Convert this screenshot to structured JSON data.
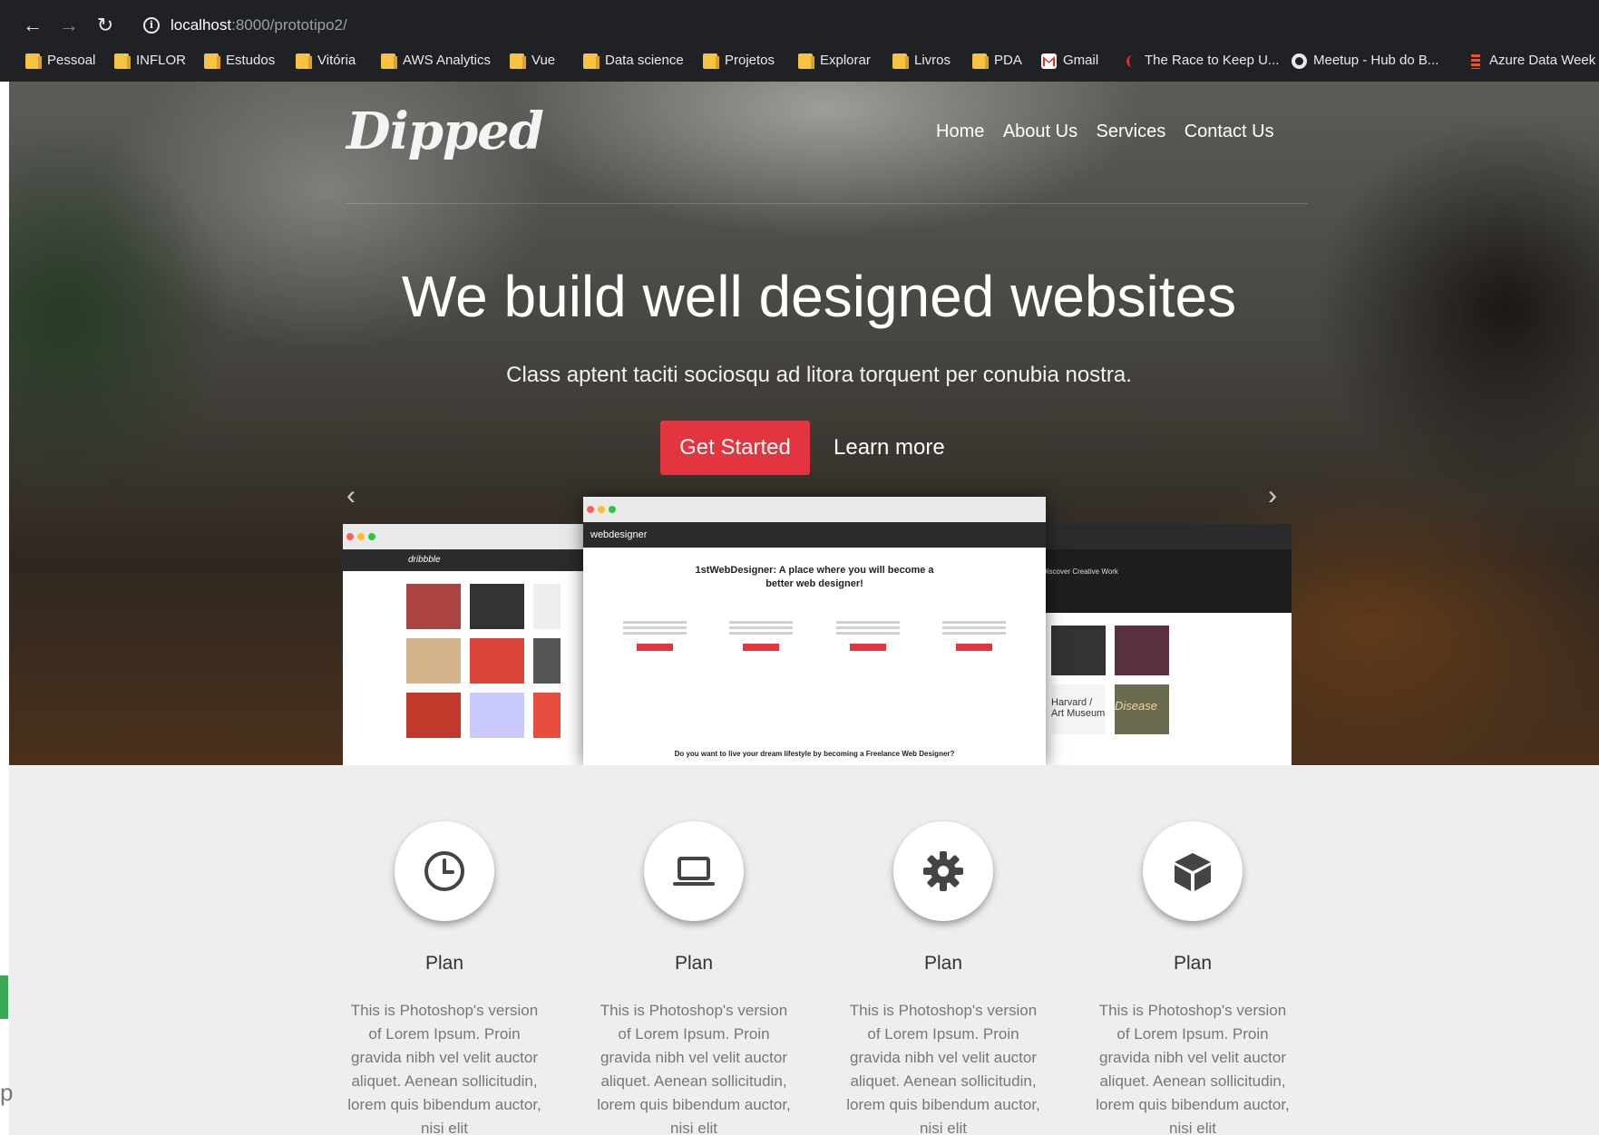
{
  "browser": {
    "url_host": "localhost",
    "url_path": ":8000/prototipo2/",
    "bookmarks": [
      {
        "label": "Pessoal",
        "icon": "folder-icon"
      },
      {
        "label": "INFLOR",
        "icon": "folder-icon"
      },
      {
        "label": "Estudos",
        "icon": "folder-icon"
      },
      {
        "label": "Vitória",
        "icon": "folder-icon"
      },
      {
        "label": "AWS Analytics",
        "icon": "folder-icon"
      },
      {
        "label": "Vue",
        "icon": "folder-icon"
      },
      {
        "label": "Data science",
        "icon": "folder-icon"
      },
      {
        "label": "Projetos",
        "icon": "folder-icon"
      },
      {
        "label": "Explorar",
        "icon": "folder-icon"
      },
      {
        "label": "Livros",
        "icon": "folder-icon"
      },
      {
        "label": "PDA",
        "icon": "folder-icon"
      },
      {
        "label": "Gmail",
        "icon": "gmail-icon"
      },
      {
        "label": "The Race to Keep U...",
        "icon": "race-icon"
      },
      {
        "label": "Meetup - Hub do B...",
        "icon": "meetup-icon"
      },
      {
        "label": "Azure Data Week -",
        "icon": "azure-icon"
      }
    ]
  },
  "site": {
    "brand": "Dipped",
    "nav": [
      "Home",
      "About Us",
      "Services",
      "Contact Us"
    ],
    "hero": {
      "title": "We build well designed websites",
      "subtitle": "Class aptent taciti sociosqu ad litora torquent per conubia nostra.",
      "cta_primary": "Get Started",
      "cta_secondary": "Learn more"
    },
    "mockups": {
      "center_logo": "webdesigner",
      "center_headline": "1stWebDesigner: A place where you will become a better web designer!",
      "center_footer": "Do you want to live your dream lifestyle by becoming a Freelance Web Designer?",
      "left_logo": "dribbble",
      "right_heading": "Discover Creative Work",
      "right_caption_a": "Harvard / Art Museum",
      "right_caption_b": "Disease"
    },
    "features": [
      {
        "icon": "clock-icon",
        "title": "Plan",
        "text": "This is Photoshop's version of Lorem Ipsum. Proin gravida nibh vel velit auctor aliquet. Aenean sollicitudin, lorem quis bibendum auctor, nisi elit"
      },
      {
        "icon": "laptop-icon",
        "title": "Plan",
        "text": "This is Photoshop's version of Lorem Ipsum. Proin gravida nibh vel velit auctor aliquet. Aenean sollicitudin, lorem quis bibendum auctor, nisi elit"
      },
      {
        "icon": "gear-icon",
        "title": "Plan",
        "text": "This is Photoshop's version of Lorem Ipsum. Proin gravida nibh vel velit auctor aliquet. Aenean sollicitudin, lorem quis bibendum auctor, nisi elit"
      },
      {
        "icon": "cube-icon",
        "title": "Plan",
        "text": "This is Photoshop's version of Lorem Ipsum. Proin gravida nibh vel velit auctor aliquet. Aenean sollicitudin, lorem quis bibendum auctor, nisi elit"
      }
    ],
    "side_fragment": "p"
  },
  "colors": {
    "accent": "#e2353f",
    "chrome_bg": "#202124",
    "features_bg": "#eeeeee"
  }
}
